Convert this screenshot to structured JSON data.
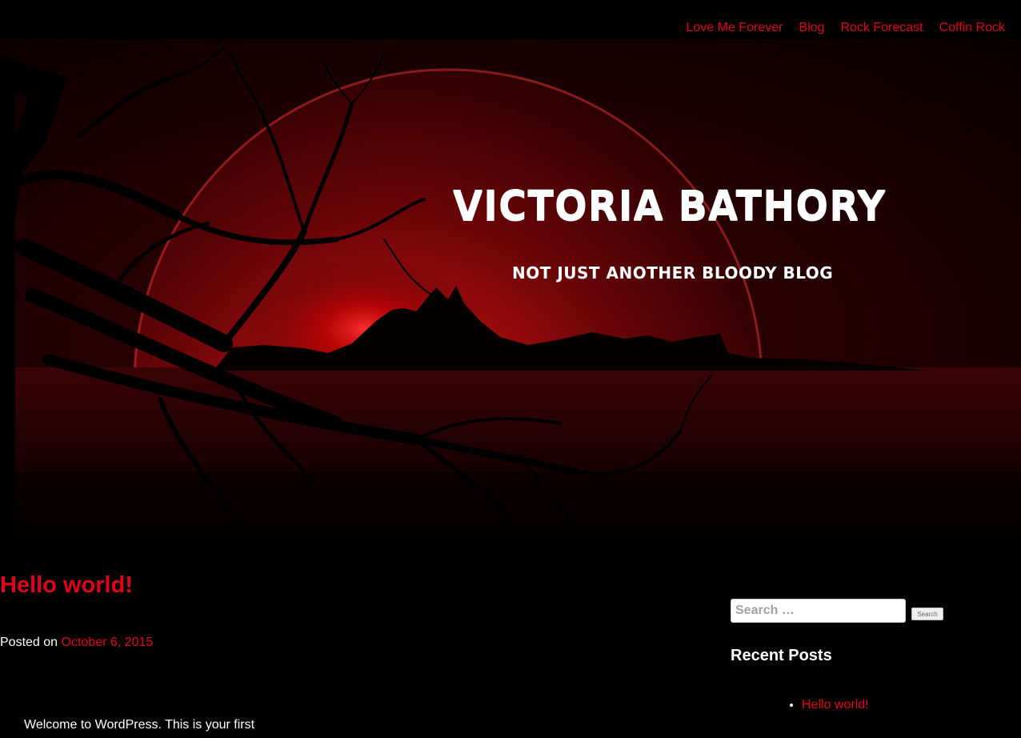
{
  "nav": {
    "items": [
      {
        "label": "Love Me Forever"
      },
      {
        "label": "Blog"
      },
      {
        "label": "Rock Forecast"
      },
      {
        "label": "Coffin Rock"
      }
    ]
  },
  "header": {
    "site_title": "VICTORIA BATHORY",
    "tagline": "NOT JUST ANOTHER BLOODY BLOG",
    "image": "blood-moon-over-sea-with-dead-tree-silhouette"
  },
  "post": {
    "title": "Hello world!",
    "meta_prefix": "Posted on",
    "date": "October 6, 2015",
    "excerpt": "Welcome to WordPress. This is your first"
  },
  "sidebar": {
    "search": {
      "placeholder": "Search …",
      "button_label": "Search"
    },
    "recent_posts": {
      "title": "Recent Posts",
      "items": [
        {
          "label": "Hello world!"
        }
      ]
    }
  },
  "colors": {
    "background": "#000000",
    "accent": "#e0001b",
    "text": "#ffffff"
  }
}
